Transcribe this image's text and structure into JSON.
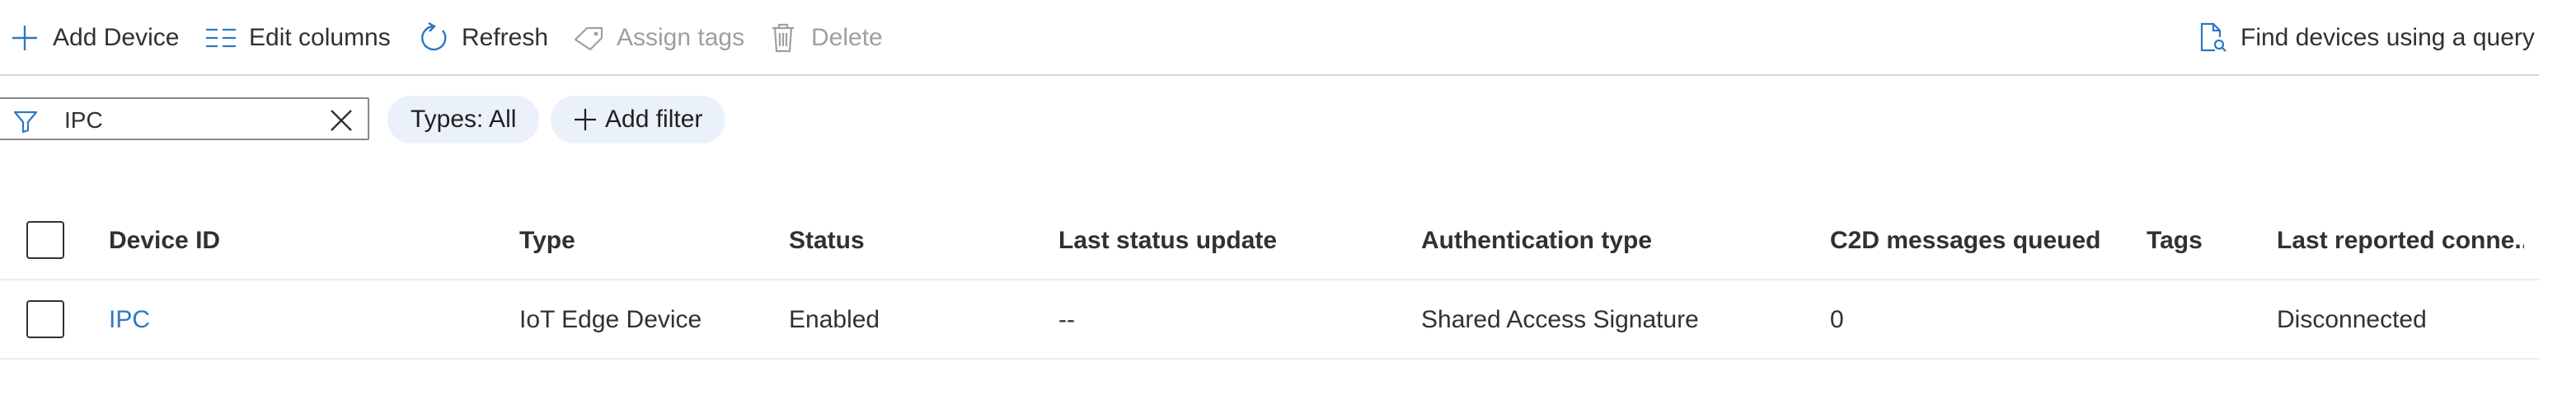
{
  "toolbar": {
    "add_device": "Add Device",
    "edit_columns": "Edit columns",
    "refresh": "Refresh",
    "assign_tags": "Assign tags",
    "delete": "Delete",
    "find_devices": "Find devices using a query"
  },
  "filter": {
    "value": "IPC",
    "types_pill": "Types: All",
    "add_filter": "Add filter"
  },
  "table": {
    "columns": [
      "Device ID",
      "Type",
      "Status",
      "Last status update",
      "Authentication type",
      "C2D messages queued",
      "Tags",
      "Last reported conne..."
    ],
    "rows": [
      {
        "device_id": "IPC",
        "type": "IoT Edge Device",
        "status": "Enabled",
        "last_status_update": "--",
        "authentication_type": "Shared Access Signature",
        "c2d_messages_queued": "0",
        "tags": "",
        "last_reported_connection": "Disconnected"
      }
    ]
  },
  "colors": {
    "accent": "#2b79c4",
    "pill_bg": "#eaf1fb",
    "disabled_text": "#a19f9d"
  }
}
